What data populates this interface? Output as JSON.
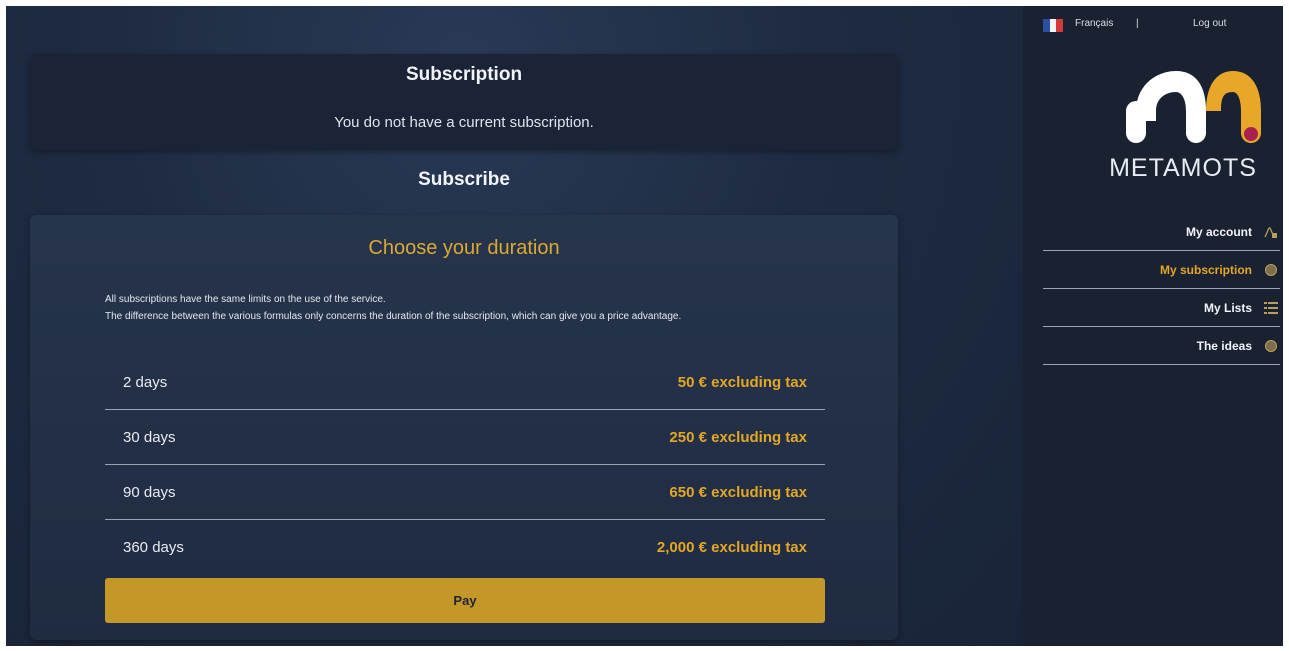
{
  "subscription": {
    "title": "Subscription",
    "status_text": "You do not have a current subscription."
  },
  "subscribe": {
    "title": "Subscribe",
    "choose_title": "Choose your duration",
    "description_line1": "All subscriptions have the same limits on the use of the service.",
    "description_line2": "The difference between the various formulas only concerns the duration of the subscription, which can give you a price advantage.",
    "options": [
      {
        "duration": "2 days",
        "price": "50 € excluding tax"
      },
      {
        "duration": "30 days",
        "price": "250 € excluding tax"
      },
      {
        "duration": "90 days",
        "price": "650 € excluding tax"
      },
      {
        "duration": "360 days",
        "price": "2,000 € excluding tax"
      }
    ],
    "pay_label": "Pay"
  },
  "header": {
    "language": "Français",
    "separator": "|",
    "logout": "Log out"
  },
  "brand": {
    "name": "METAMOTS"
  },
  "nav": {
    "items": [
      {
        "label": "My account",
        "icon": "account-icon",
        "active": false
      },
      {
        "label": "My subscription",
        "icon": "circle-icon",
        "active": true
      },
      {
        "label": "My Lists",
        "icon": "list-icon",
        "active": false
      },
      {
        "label": "The ideas",
        "icon": "circle-icon",
        "active": false
      }
    ]
  },
  "colors": {
    "accent": "#e3a723",
    "pay_button": "#c49828",
    "background": "#1f2b41",
    "logo_dot": "#a8224e"
  }
}
